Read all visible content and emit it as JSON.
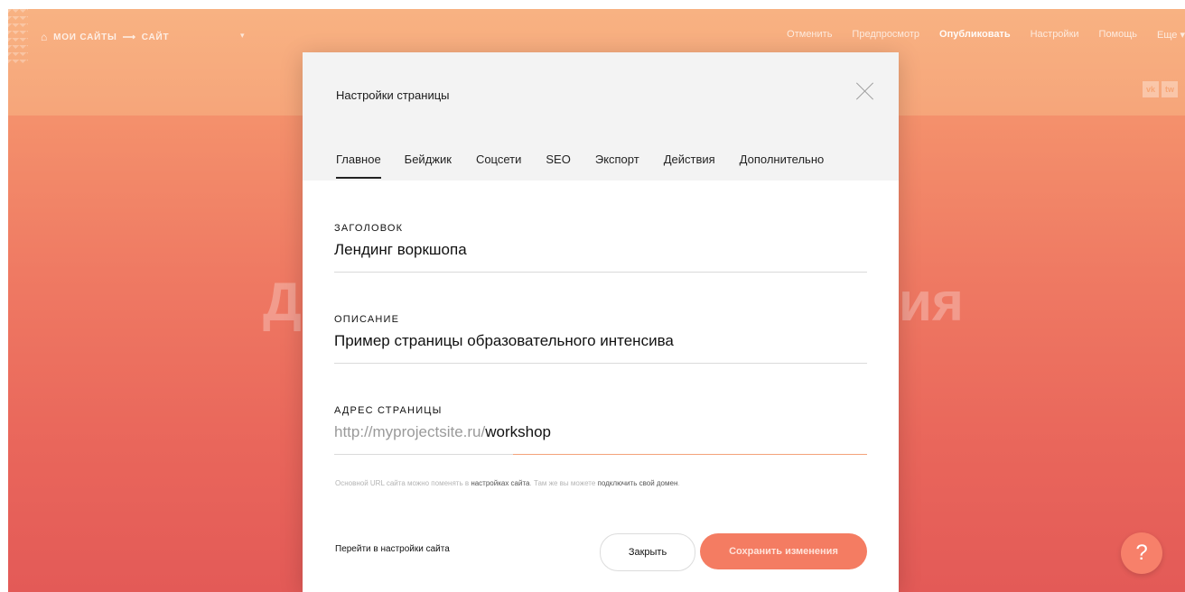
{
  "topbar": {
    "breadcrumb": {
      "home_icon": "home-icon",
      "my_sites": "МОИ САЙТЫ",
      "arrow": "⟶",
      "site": "САЙТ",
      "caret": "▾"
    },
    "menu": {
      "cancel": "Отменить",
      "preview": "Предпросмотр",
      "publish": "Опубликовать",
      "settings": "Настройки",
      "help": "Помощь",
      "more": "Еще ▾"
    },
    "social": {
      "vk": "vk",
      "twitter": "tw"
    }
  },
  "hero": {
    "left_letter": "Д",
    "right_letters": "ия"
  },
  "help_button": "?",
  "modal": {
    "title": "Настройки страницы",
    "tabs": [
      {
        "label": "Главное"
      },
      {
        "label": "Бейджик"
      },
      {
        "label": "Соцсети"
      },
      {
        "label": "SEO"
      },
      {
        "label": "Экспорт"
      },
      {
        "label": "Действия"
      },
      {
        "label": "Дополнительно"
      }
    ],
    "active_tab": "Главное",
    "fields": {
      "title_label": "ЗАГОЛОВОК",
      "title_value": "Лендинг воркшопа",
      "description_label": "ОПИСАНИЕ",
      "description_value": "Пример страницы образовательного интенсива",
      "address_label": "АДРЕС СТРАНИЦЫ",
      "address_prefix": "http://myprojectsite.ru/",
      "address_value": "workshop"
    },
    "hint": {
      "part1": "Основной URL сайта можно поменять в ",
      "link1": "настройках сайта",
      "part2": ". Там же вы можете ",
      "link2": "подключить свой домен",
      "part3": "."
    },
    "footer": {
      "site_settings_link": "Перейти в настройки сайта",
      "close_button": "Закрыть",
      "save_button": "Сохранить изменения"
    }
  },
  "colors": {
    "accent": "#f47c62",
    "background_top": "#f7a676",
    "background_bottom": "#e35a57"
  }
}
